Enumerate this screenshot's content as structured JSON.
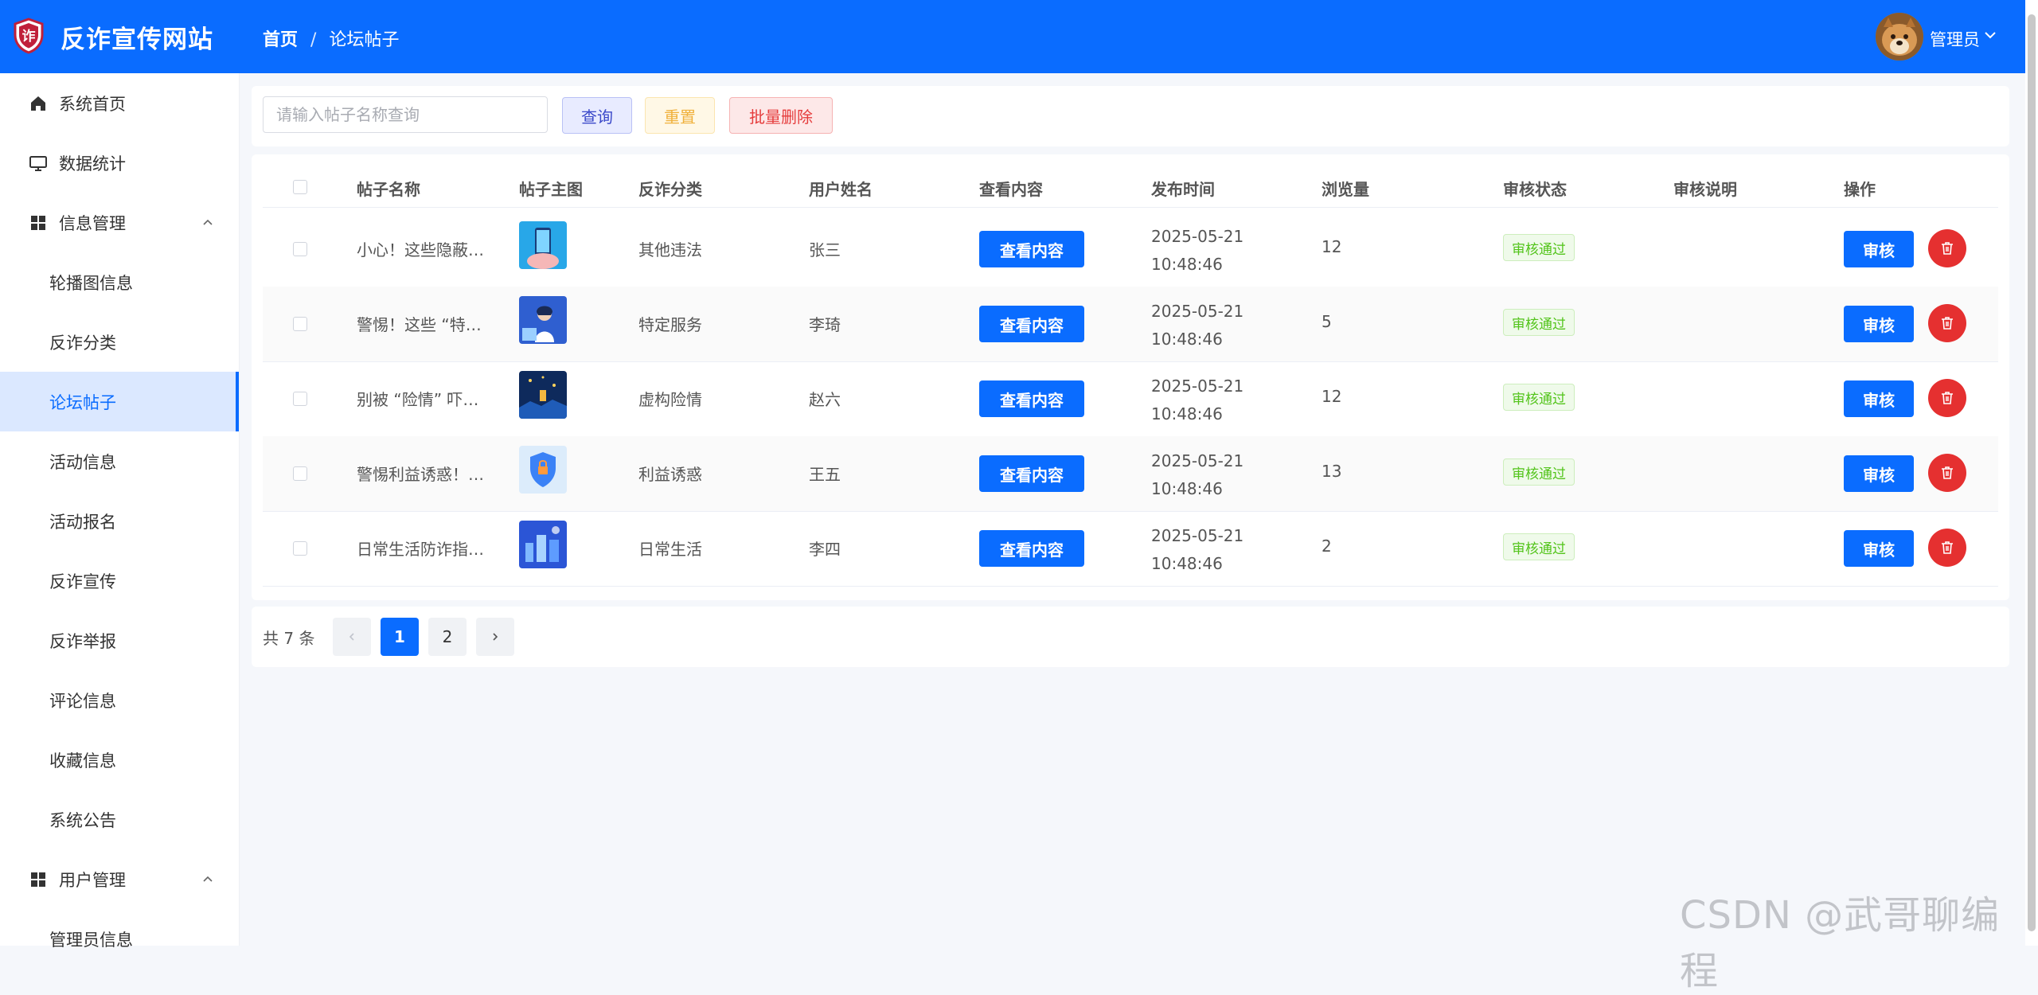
{
  "header": {
    "site_title": "反诈宣传网站",
    "logo_glyph": "诈",
    "breadcrumb": {
      "home": "首页",
      "separator": "/",
      "current": "论坛帖子"
    },
    "user_name": "管理员",
    "brand_color": "#0a6cff"
  },
  "sidebar": {
    "items": [
      {
        "label": "系统首页",
        "icon": "home-icon"
      },
      {
        "label": "数据统计",
        "icon": "monitor-icon"
      },
      {
        "label": "信息管理",
        "icon": "grid-icon",
        "expanded": true
      },
      {
        "label": "轮播图信息"
      },
      {
        "label": "反诈分类"
      },
      {
        "label": "论坛帖子",
        "active": true
      },
      {
        "label": "活动信息"
      },
      {
        "label": "活动报名"
      },
      {
        "label": "反诈宣传"
      },
      {
        "label": "反诈举报"
      },
      {
        "label": "评论信息"
      },
      {
        "label": "收藏信息"
      },
      {
        "label": "系统公告"
      },
      {
        "label": "用户管理",
        "icon": "grid-icon",
        "expanded": true
      },
      {
        "label": "管理员信息"
      }
    ]
  },
  "search": {
    "placeholder": "请输入帖子名称查询",
    "value": "",
    "query_label": "查询",
    "reset_label": "重置",
    "batch_delete_label": "批量删除"
  },
  "table": {
    "columns": [
      "帖子名称",
      "帖子主图",
      "反诈分类",
      "用户姓名",
      "查看内容",
      "发布时间",
      "浏览量",
      "审核状态",
      "审核说明",
      "操作"
    ],
    "rows": [
      {
        "name": "小心！这些隐蔽…",
        "category": "其他违法",
        "user": "张三",
        "view_label": "查看内容",
        "date": "2025-05-21",
        "time": "10:48:46",
        "views": "12",
        "status": "审核通过",
        "note": "",
        "audit_label": "审核"
      },
      {
        "name": "警惕！这些 “特…",
        "category": "特定服务",
        "user": "李琦",
        "view_label": "查看内容",
        "date": "2025-05-21",
        "time": "10:48:46",
        "views": "5",
        "status": "审核通过",
        "note": "",
        "audit_label": "审核"
      },
      {
        "name": "别被 “险情” 吓…",
        "category": "虚构险情",
        "user": "赵六",
        "view_label": "查看内容",
        "date": "2025-05-21",
        "time": "10:48:46",
        "views": "12",
        "status": "审核通过",
        "note": "",
        "audit_label": "审核"
      },
      {
        "name": "警惕利益诱惑！…",
        "category": "利益诱惑",
        "user": "王五",
        "view_label": "查看内容",
        "date": "2025-05-21",
        "time": "10:48:46",
        "views": "13",
        "status": "审核通过",
        "note": "",
        "audit_label": "审核"
      },
      {
        "name": "日常生活防诈指…",
        "category": "日常生活",
        "user": "李四",
        "view_label": "查看内容",
        "date": "2025-05-21",
        "time": "10:48:46",
        "views": "2",
        "status": "审核通过",
        "note": "",
        "audit_label": "审核"
      }
    ]
  },
  "pagination": {
    "total_label": "共 7 条",
    "pages": [
      "1",
      "2"
    ],
    "current": "1"
  },
  "watermark": "CSDN @武哥聊编程"
}
